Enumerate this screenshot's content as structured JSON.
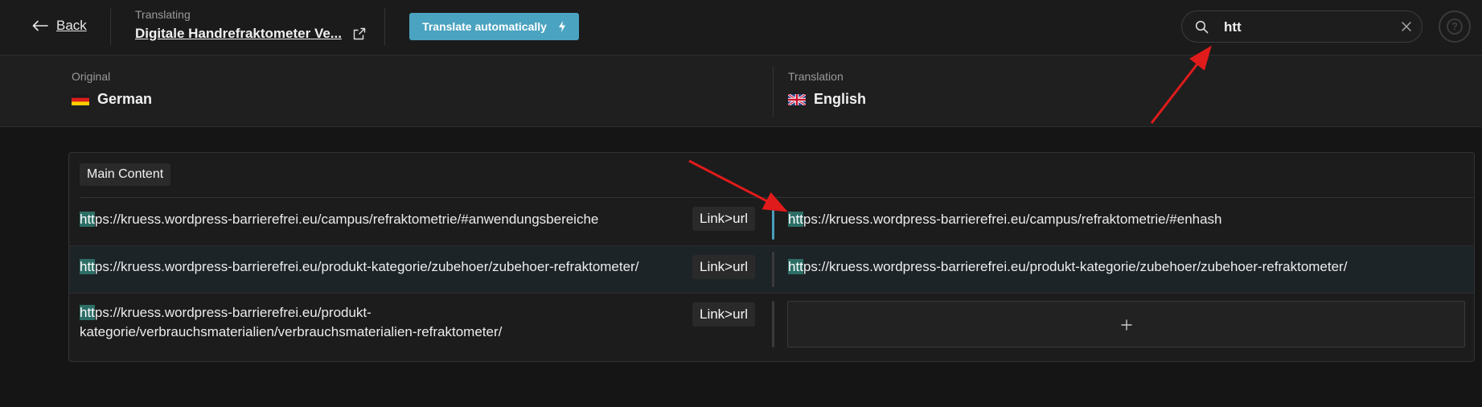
{
  "header": {
    "back_label": "Back",
    "translating_label": "Translating",
    "document_title": "Digitale Handrefraktometer Ve...",
    "translate_button_label": "Translate automatically",
    "search": {
      "value": "htt"
    },
    "help_icon_glyph": "?"
  },
  "languages": {
    "original_label": "Original",
    "original_name": "German",
    "translation_label": "Translation",
    "translation_name": "English"
  },
  "content": {
    "section_title": "Main Content",
    "rows": [
      {
        "source_match": "htt",
        "source_rest": "ps://kruess.wordpress-barrierefrei.eu/campus/refraktometrie/#anwendungsbereiche",
        "tag": "Link>url",
        "target_match": "htt",
        "target_rest": "ps://kruess.wordpress-barrierefrei.eu/campus/refraktometrie/#enhash"
      },
      {
        "source_match": "htt",
        "source_rest": "ps://kruess.wordpress-barrierefrei.eu/produkt-kategorie/zubehoer/zubehoer-refraktometer/",
        "tag": "Link>url",
        "target_match": "htt",
        "target_rest": "ps://kruess.wordpress-barrierefrei.eu/produkt-kategorie/zubehoer/zubehoer-refraktometer/"
      },
      {
        "source_match": "htt",
        "source_rest_line1": "ps://kruess.wordpress-barrierefrei.eu/produkt-",
        "source_rest_line2": "kategorie/verbrauchsmaterialien/verbrauchsmaterialien-refraktometer/",
        "tag": "Link>url"
      }
    ]
  },
  "colors": {
    "accent": "#4aa3c0",
    "match_highlight": "#2c6e66",
    "annotation_arrow": "#e01b1b"
  },
  "icons": [
    "arrow-left-icon",
    "external-link-icon",
    "lightning-icon",
    "search-icon",
    "close-icon",
    "help-icon",
    "germany-flag-icon",
    "uk-flag-icon",
    "plus-icon"
  ]
}
